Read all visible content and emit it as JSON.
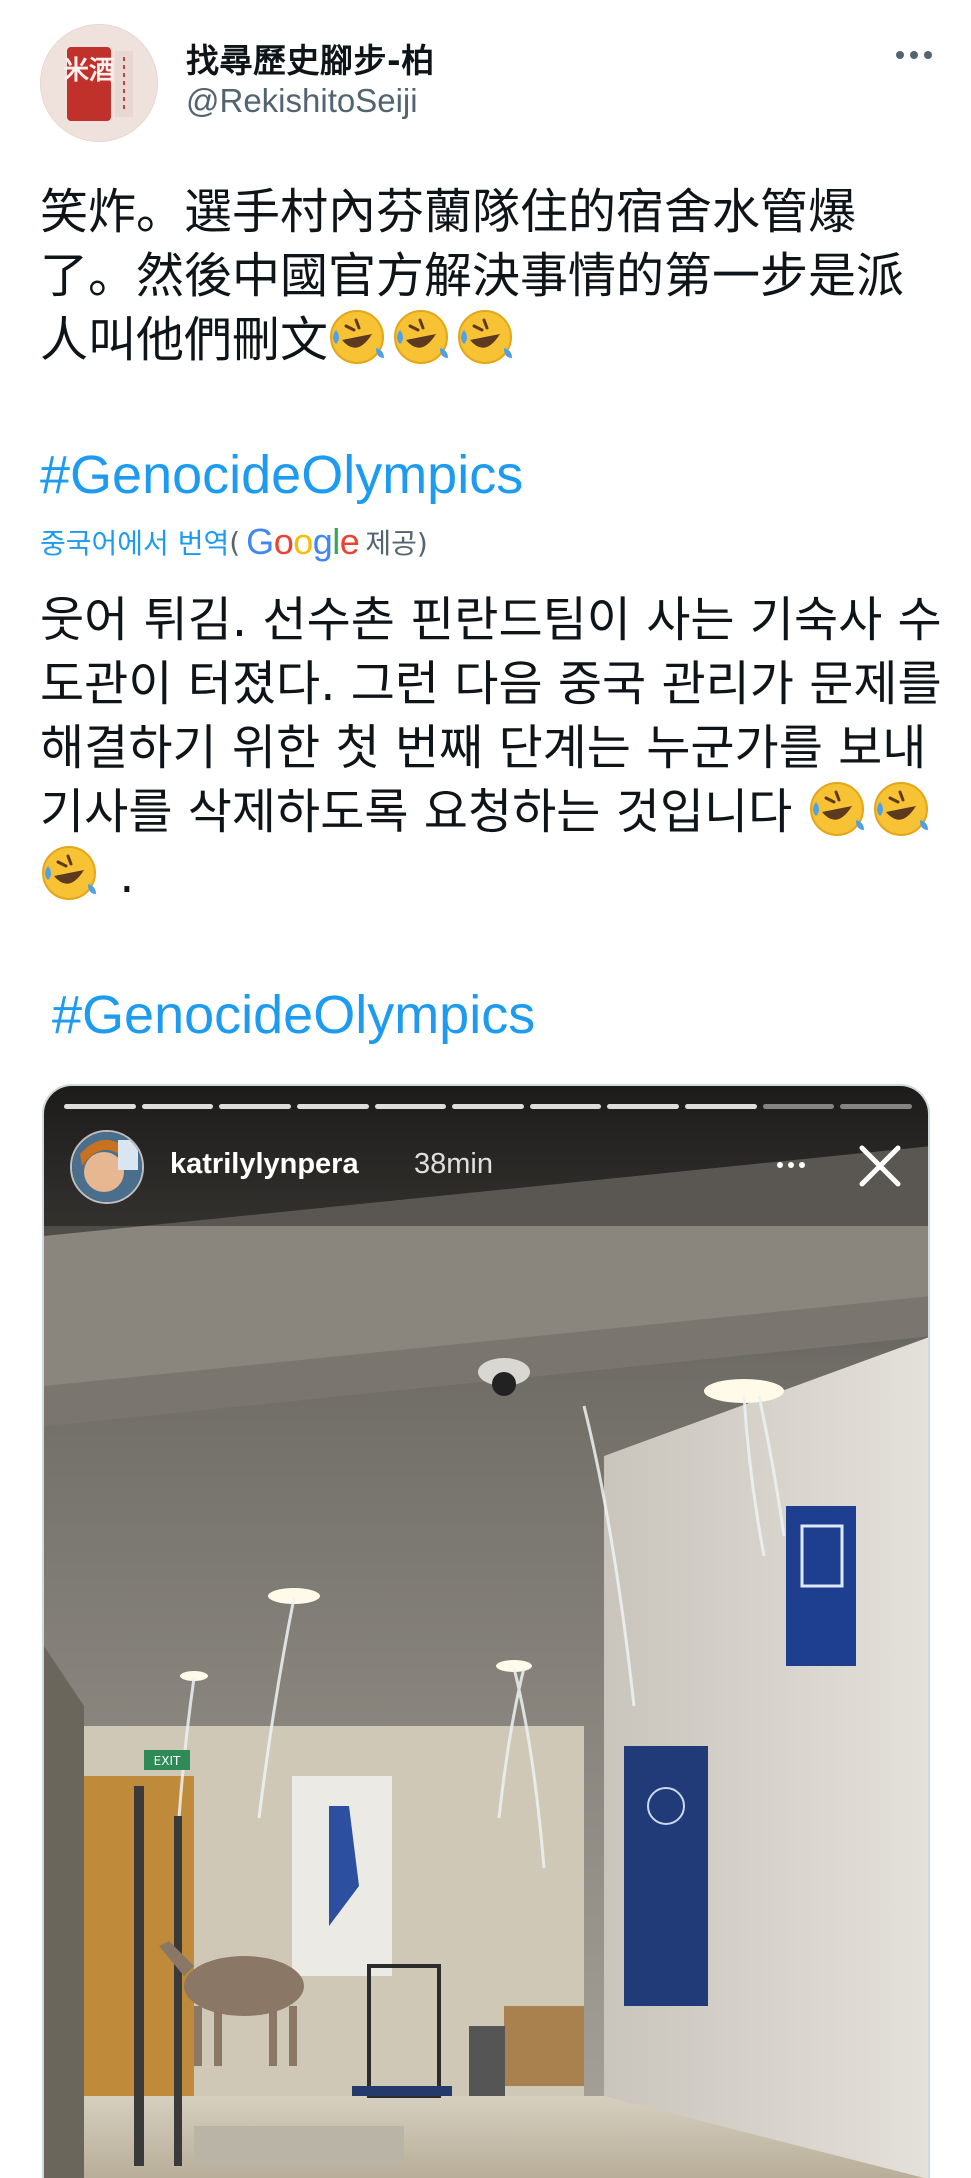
{
  "author": {
    "display_name": "找尋歷史腳步-柏",
    "handle": "@RekishitoSeiji",
    "avatar_text": "米酒"
  },
  "tweet": {
    "text": "笑炸。選手村內芬蘭隊住的宿舍水管爆了。然後中國官方解決事情的第一步是派人叫他們刪文",
    "emoji_count": 3,
    "emoji_name": "rolling-on-the-floor-laughing",
    "hashtag": "#GenocideOlympics"
  },
  "translation": {
    "label": "중국어에서 번역",
    "open_paren": "(",
    "provider": "Google",
    "provider_suffix": "제공)",
    "text": "웃어 튀김. 선수촌 핀란드팀이 사는 기숙사 수도관이 터졌다. 그런 다음 중국 관리가 문제를 해결하기 위한 첫 번째 단계는 누군가를 보내 기사를 삭제하도록 요청하는 것입니다",
    "trailing": ".",
    "hashtag": "#GenocideOlympics"
  },
  "media": {
    "story_user": "katrilylynpera",
    "story_time": "38min",
    "exit_sign": "EXIT"
  },
  "colors": {
    "link": "#1d9bf0",
    "secondary_text": "#536471",
    "text": "#0f1419"
  }
}
